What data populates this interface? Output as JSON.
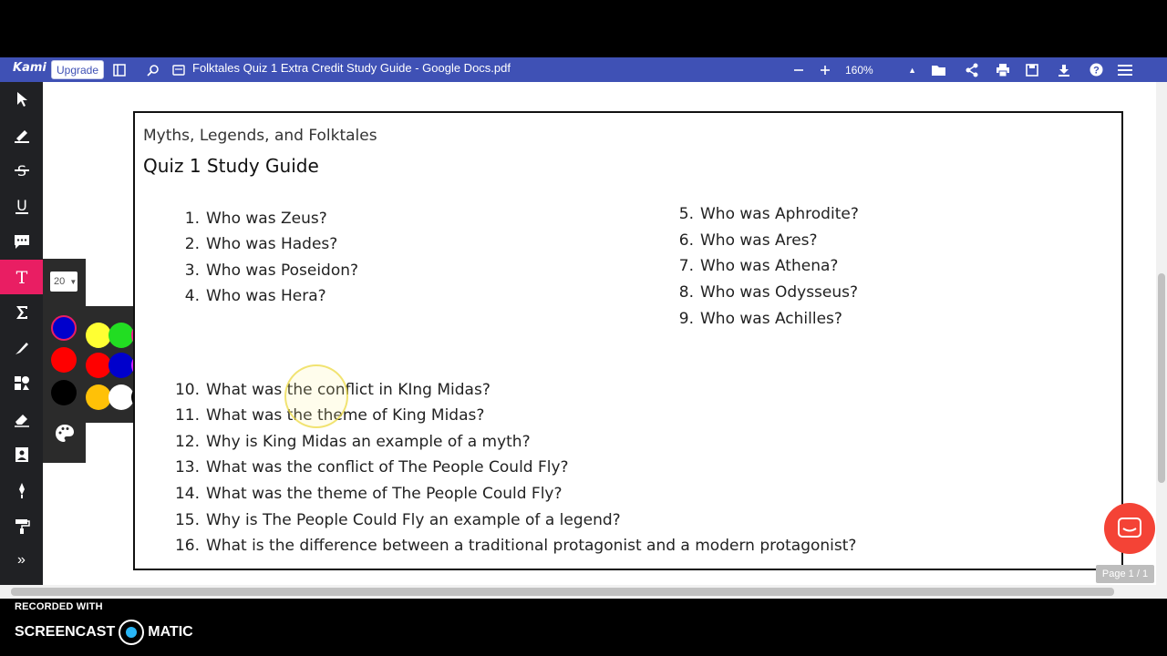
{
  "toolbar": {
    "brand": "Kami",
    "upgrade_label": "Upgrade",
    "doc_title": "Folktales Quiz 1 Extra Credit Study Guide - Google Docs.pdf",
    "zoom_value": "160%",
    "bg_color": "#3f51b5"
  },
  "left_tools": {
    "active_tool": "text-tool",
    "accent_color": "#e91e63",
    "font_size": "20",
    "colors": [
      "#0000cc",
      "#ffff33",
      "#22dd22",
      "#ff1493",
      "#ff0000",
      "#ff0000",
      "#0000cc",
      "#dd22ff",
      "#000000",
      "#ffc107",
      "#ffffff",
      "#000000"
    ]
  },
  "document": {
    "subtitle": "Myths, Legends, and Folktales",
    "title": "Quiz 1 Study Guide",
    "questions_left": [
      {
        "num": "1.",
        "text": "Who was Zeus?"
      },
      {
        "num": "2.",
        "text": "Who was Hades?"
      },
      {
        "num": "3.",
        "text": "Who was Poseidon?"
      },
      {
        "num": "4.",
        "text": "Who was Hera?"
      }
    ],
    "questions_right": [
      {
        "num": "5.",
        "text": "Who was Aphrodite?"
      },
      {
        "num": "6.",
        "text": "Who was Ares?"
      },
      {
        "num": "7.",
        "text": "Who was Athena?"
      },
      {
        "num": "8.",
        "text": "Who was Odysseus?"
      },
      {
        "num": "9.",
        "text": "Who was Achilles?"
      }
    ],
    "questions_bottom": [
      {
        "num": "10.",
        "text": "What was the conflict in KIng Midas?"
      },
      {
        "num": "11.",
        "text": "What was the theme of King Midas?"
      },
      {
        "num": "12.",
        "text": "Why is King Midas an example of a myth?"
      },
      {
        "num": "13.",
        "text": "What was the conflict of The People Could Fly?"
      },
      {
        "num": "14.",
        "text": "What was the theme of The People Could Fly?"
      },
      {
        "num": "15.",
        "text": "Why is The People Could Fly an example of a legend?"
      },
      {
        "num": "16.",
        "text": "What is the difference between a traditional protagonist and a modern protagonist?"
      }
    ]
  },
  "page_indicator": "Page 1 / 1",
  "screencast": {
    "recorded_with": "RECORDED WITH",
    "brand_left": "SCREENCAST",
    "brand_right": "MATIC"
  }
}
